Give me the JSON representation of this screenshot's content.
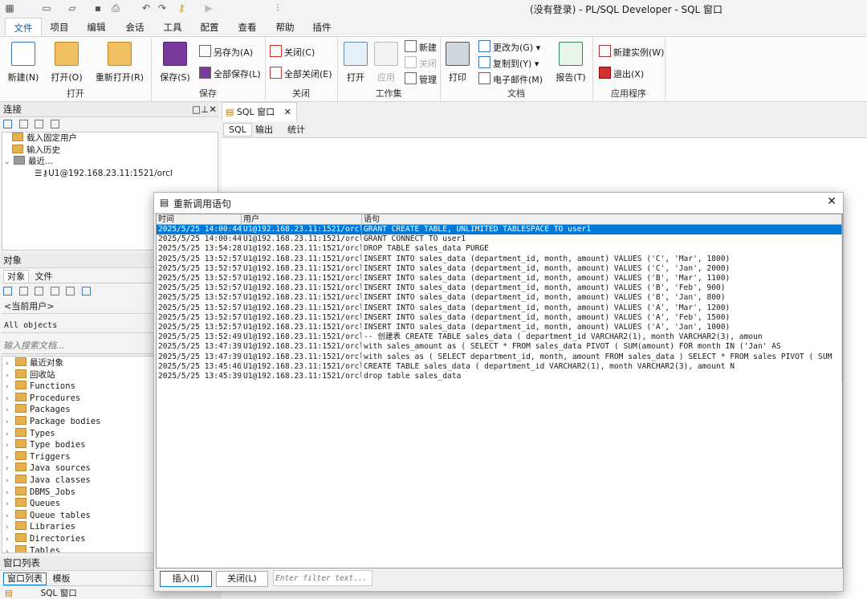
{
  "window": {
    "title": "(没有登录) - PL/SQL Developer - SQL 窗口"
  },
  "menu_tabs": [
    "文件",
    "项目",
    "编辑",
    "会话",
    "工具",
    "配置",
    "查看",
    "帮助",
    "插件"
  ],
  "ribbon": {
    "open_group": {
      "label": "打开",
      "new": "新建(N)",
      "open": "打开(O)",
      "reopen": "重新打开(R)"
    },
    "save_group": {
      "label": "保存",
      "save": "保存(S)",
      "save_as": "另存为(A)",
      "save_all": "全部保存(L)"
    },
    "close_group": {
      "label": "关闭",
      "close": "关闭(C)",
      "close_all": "全部关闭(E)"
    },
    "workset_group": {
      "label": "工作集",
      "open": "打开",
      "apply": "应用",
      "new": "新建",
      "close": "关闭",
      "manage": "管理"
    },
    "doc_group": {
      "label": "文档",
      "print": "打印",
      "change_to": "更改为(G)",
      "copy_to": "复制到(Y)",
      "email": "电子邮件(M)",
      "report": "报告(T)"
    },
    "app_group": {
      "label": "应用程序",
      "new_instance": "新建实例(W)",
      "exit": "退出(X)"
    }
  },
  "connection_panel": {
    "title": "连接",
    "items": [
      "载入固定用户",
      "输入历史",
      "最近...",
      "U1@192.168.23.11:1521/orcl"
    ]
  },
  "objects_panel": {
    "title": "对象",
    "tabs": [
      "对象",
      "文件"
    ],
    "current_user": "<当前用户>",
    "filter": "All objects",
    "search_placeholder": "输入搜索文档...",
    "items": [
      "最近对象",
      "回收站",
      "Functions",
      "Procedures",
      "Packages",
      "Package bodies",
      "Types",
      "Type bodies",
      "Triggers",
      "Java sources",
      "Java classes",
      "DBMS_Jobs",
      "Queues",
      "Queue tables",
      "Libraries",
      "Directories",
      "Tables"
    ]
  },
  "window_list_panel": {
    "title": "窗口列表",
    "tabs": [
      "窗口列表",
      "模板"
    ],
    "item": "SQL 窗口"
  },
  "sql_window": {
    "tab": "SQL 窗口",
    "subtabs": [
      "SQL",
      "输出",
      "统计"
    ]
  },
  "dialog": {
    "title": "重新调用语句",
    "columns": [
      "时间",
      "用户",
      "语句"
    ],
    "rows": [
      [
        "2025/5/25 14:00:44",
        "U1@192.168.23.11:1521/orcl",
        "GRANT CREATE TABLE, UNLIMITED TABLESPACE TO user1"
      ],
      [
        "2025/5/25 14:00:44",
        "U1@192.168.23.11:1521/orcl",
        "GRANT CONNECT TO user1"
      ],
      [
        "2025/5/25 13:54:28",
        "U1@192.168.23.11:1521/orcl",
        "DROP TABLE sales_data PURGE"
      ],
      [
        "2025/5/25 13:52:57",
        "U1@192.168.23.11:1521/orcl",
        "INSERT INTO sales_data (department_id, month, amount) VALUES ('C', 'Mar', 1800)"
      ],
      [
        "2025/5/25 13:52:57",
        "U1@192.168.23.11:1521/orcl",
        "INSERT INTO sales_data (department_id, month, amount) VALUES ('C', 'Jan', 2000)"
      ],
      [
        "2025/5/25 13:52:57",
        "U1@192.168.23.11:1521/orcl",
        "INSERT INTO sales_data (department_id, month, amount) VALUES ('B', 'Mar', 1100)"
      ],
      [
        "2025/5/25 13:52:57",
        "U1@192.168.23.11:1521/orcl",
        "INSERT INTO sales_data (department_id, month, amount) VALUES ('B', 'Feb', 900)"
      ],
      [
        "2025/5/25 13:52:57",
        "U1@192.168.23.11:1521/orcl",
        "INSERT INTO sales_data (department_id, month, amount) VALUES ('B', 'Jan', 800)"
      ],
      [
        "2025/5/25 13:52:57",
        "U1@192.168.23.11:1521/orcl",
        "INSERT INTO sales_data (department_id, month, amount) VALUES ('A', 'Mar', 1200)"
      ],
      [
        "2025/5/25 13:52:57",
        "U1@192.168.23.11:1521/orcl",
        "INSERT INTO sales_data (department_id, month, amount) VALUES ('A', 'Feb', 1500)"
      ],
      [
        "2025/5/25 13:52:57",
        "U1@192.168.23.11:1521/orcl",
        "INSERT INTO sales_data (department_id, month, amount) VALUES ('A', 'Jan', 1000)"
      ],
      [
        "2025/5/25 13:52:49",
        "U1@192.168.23.11:1521/orcl",
        "-- 创建表 CREATE TABLE sales_data (     department_id VARCHAR2(1),      month           VARCHAR2(3),      amoun"
      ],
      [
        "2025/5/25 13:47:39",
        "U1@192.168.23.11:1521/orcl",
        "with sales_amount as (   SELECT * FROM sales_data   PIVOT (        SUM(amount)        FOR month IN ('Jan' AS"
      ],
      [
        "2025/5/25 13:47:39",
        "U1@192.168.23.11:1521/orcl",
        "with sales as (   SELECT department_id, month, amount FROM sales_data ) SELECT * FROM sales PIVOT (     SUM"
      ],
      [
        "2025/5/25 13:45:46",
        "U1@192.168.23.11:1521/orcl",
        "CREATE TABLE sales_data (     department_id VARCHAR2(1),      month         VARCHAR2(3),      amount      N"
      ],
      [
        "2025/5/25 13:45:39",
        "U1@192.168.23.11:1521/orcl",
        "drop table sales_data"
      ]
    ],
    "insert_button": "插入(I)",
    "close_button": "关闭(L)",
    "filter_placeholder": "Enter filter text..."
  },
  "colors": {
    "accent": "#1a5aa6",
    "selection": "#0078d7",
    "folder": "#e8b04b"
  }
}
